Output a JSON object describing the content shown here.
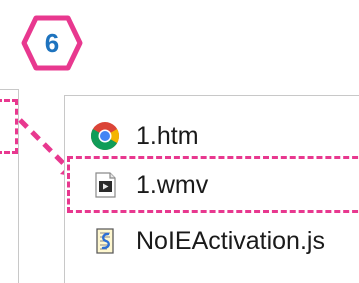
{
  "step": {
    "number": "6",
    "badge_color": "#e8388f",
    "number_color": "#1e73be"
  },
  "highlight_color": "#e8388f",
  "files": [
    {
      "name": "1.htm",
      "icon": "chrome-icon"
    },
    {
      "name": "1.wmv",
      "icon": "video-file-icon"
    },
    {
      "name": "NoIEActivation.js",
      "icon": "script-file-icon"
    }
  ]
}
